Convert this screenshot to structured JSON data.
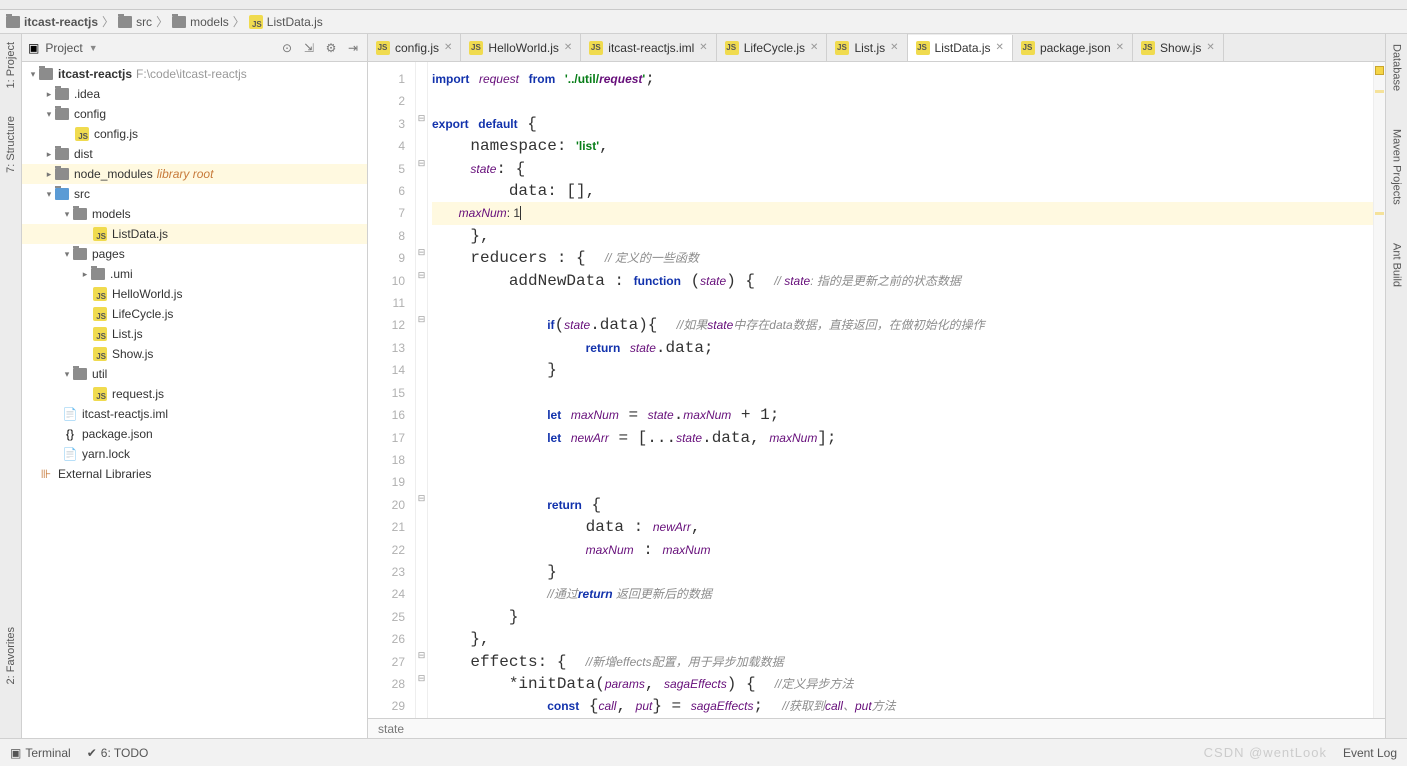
{
  "breadcrumb": {
    "project": "itcast-reactjs",
    "src": "src",
    "models": "models",
    "file": "ListData.js"
  },
  "projectPanel": {
    "title": "Project"
  },
  "tree": {
    "root": "itcast-reactjs",
    "root_path": "F:\\code\\itcast-reactjs",
    "idea": ".idea",
    "config": "config",
    "config_js": "config.js",
    "dist": "dist",
    "node_modules": "node_modules",
    "lib_root": "library root",
    "src": "src",
    "models": "models",
    "listdata": "ListData.js",
    "pages": "pages",
    "umi": ".umi",
    "hello": "HelloWorld.js",
    "life": "LifeCycle.js",
    "list": "List.js",
    "show": "Show.js",
    "util": "util",
    "request": "request.js",
    "iml": "itcast-reactjs.iml",
    "pkg": "package.json",
    "yarn": "yarn.lock",
    "ext_lib": "External Libraries"
  },
  "tabs": [
    {
      "label": "config.js",
      "active": false
    },
    {
      "label": "HelloWorld.js",
      "active": false
    },
    {
      "label": "itcast-reactjs.iml",
      "active": false
    },
    {
      "label": "LifeCycle.js",
      "active": false
    },
    {
      "label": "List.js",
      "active": false
    },
    {
      "label": "ListData.js",
      "active": true
    },
    {
      "label": "package.json",
      "active": false
    },
    {
      "label": "Show.js",
      "active": false
    }
  ],
  "lines": [
    "import request from '../util/request';",
    "",
    "export default {",
    "    namespace: 'list',",
    "    state: {",
    "        data: [],",
    "        maxNum: 1",
    "    },",
    "    reducers : {  // 定义的一些函数",
    "        addNewData : function (state) {  // state: 指的是更新之前的状态数据",
    "",
    "            if(state.data){  //如果state中存在data数据，直接返回，在做初始化的操作",
    "                return state.data;",
    "            }",
    "",
    "            let maxNum = state.maxNum + 1;",
    "            let newArr = [...state.data, maxNum];",
    "",
    "",
    "            return {",
    "                data : newArr,",
    "                maxNum : maxNum",
    "            }",
    "            //通过return 返回更新后的数据",
    "        }",
    "    },",
    "    effects: {  //新增effects配置，用于异步加载数据",
    "        *initData(params, sagaEffects) {  //定义异步方法",
    "            const {call, put} = sagaEffects;  //获取到call、put方法"
  ],
  "crumb_bottom": "state",
  "status": {
    "terminal": "Terminal",
    "todo": "6: TODO",
    "event_log": "Event Log"
  },
  "left_stripe": {
    "project": "1: Project",
    "structure": "7: Structure",
    "favorites": "2: Favorites"
  },
  "right_stripe": {
    "database": "Database",
    "maven": "Maven Projects",
    "ant": "Ant Build"
  },
  "watermark": "CSDN @wentLook"
}
